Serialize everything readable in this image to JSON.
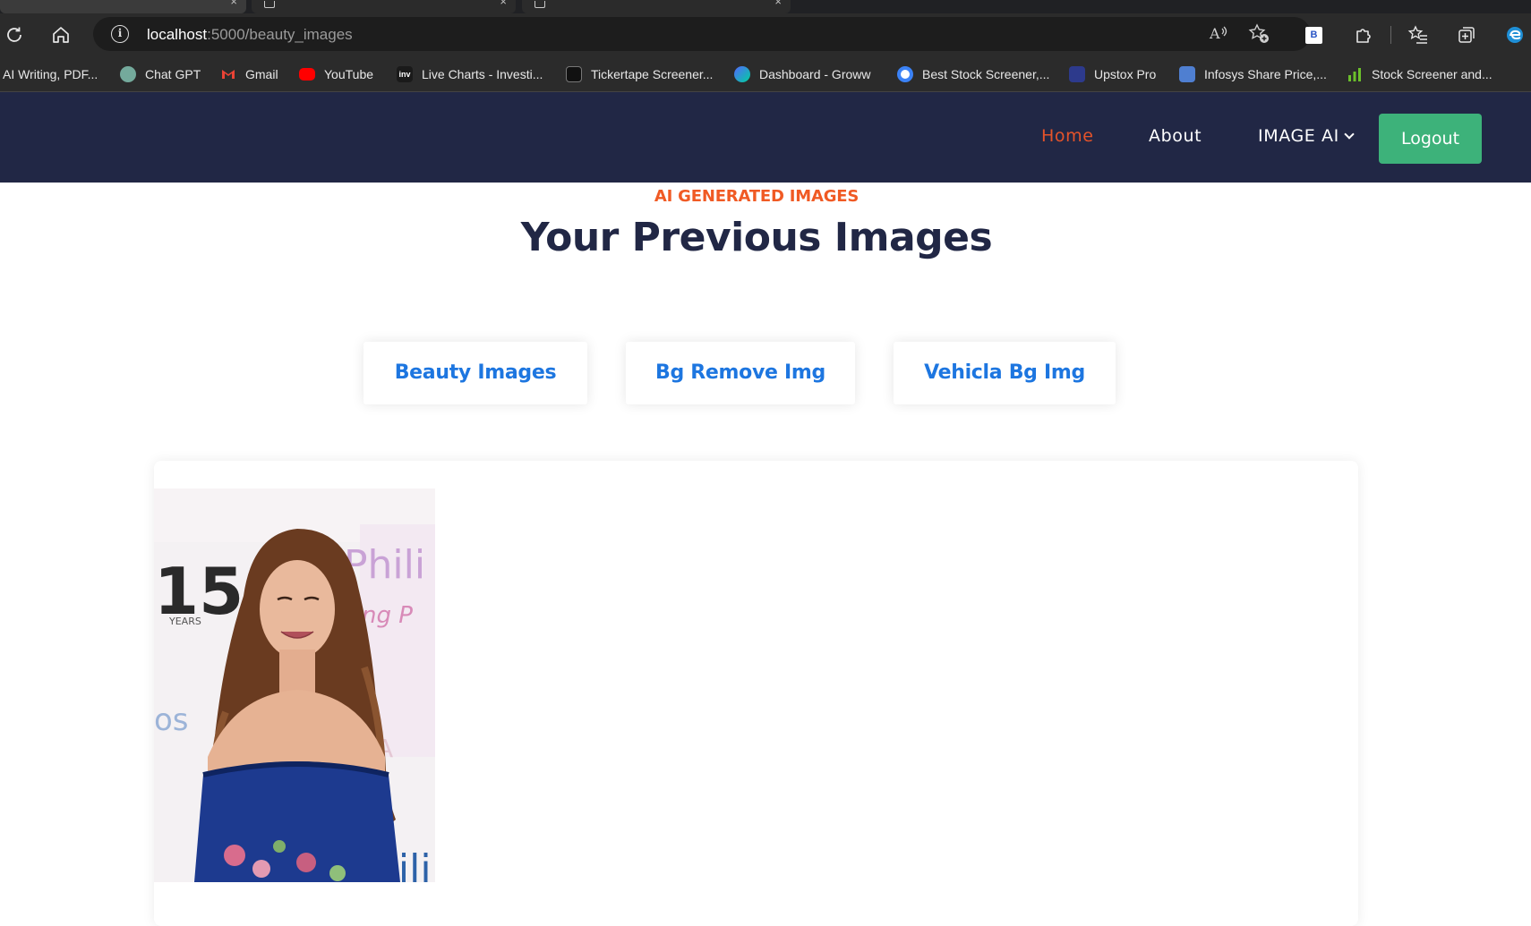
{
  "browser": {
    "url_host": "localhost",
    "url_path": ":5000/beauty_images",
    "extension_badge": "B",
    "bookmarks": [
      {
        "label": "AI Writing, PDF...",
        "icon": "none",
        "color": "#2b2b2b"
      },
      {
        "label": "Chat GPT",
        "icon": "chatgpt-icon",
        "color": "#74aa9c"
      },
      {
        "label": "Gmail",
        "icon": "gmail-icon",
        "color": "#ea4335"
      },
      {
        "label": "YouTube",
        "icon": "youtube-icon",
        "color": "#ff0000"
      },
      {
        "label": "Live Charts - Investi...",
        "icon": "investing-icon",
        "color": "#1a1a1a"
      },
      {
        "label": "Tickertape Screener...",
        "icon": "tickertape-icon",
        "color": "#111111"
      },
      {
        "label": "Dashboard - Groww",
        "icon": "groww-icon",
        "color": "#5367ff"
      },
      {
        "label": "Best Stock Screener,...",
        "icon": "screener-icon",
        "color": "#3b82f6"
      },
      {
        "label": "Upstox Pro",
        "icon": "upstox-icon",
        "color": "#2d3a8c"
      },
      {
        "label": "Infosys Share Price,...",
        "icon": "infosys-icon",
        "color": "#4f7fd1"
      },
      {
        "label": "Stock Screener and...",
        "icon": "chart-bars-icon",
        "color": "#6bbf2b"
      }
    ]
  },
  "navbar": {
    "links": [
      {
        "label": "Home",
        "active": true
      },
      {
        "label": "About",
        "active": false
      },
      {
        "label": "IMAGE AI",
        "active": false
      }
    ],
    "logout_label": "Logout"
  },
  "page": {
    "kicker": "AI GENERATED IMAGES",
    "title": "Your Previous Images",
    "filters": [
      "Beauty Images",
      "Bg Remove Img",
      "Vehicla Bg Img"
    ]
  },
  "colors": {
    "navbar_bg": "#212745",
    "accent_orange": "#f05a24",
    "logout_green": "#3db27a",
    "filter_blue": "#1d76e0"
  }
}
